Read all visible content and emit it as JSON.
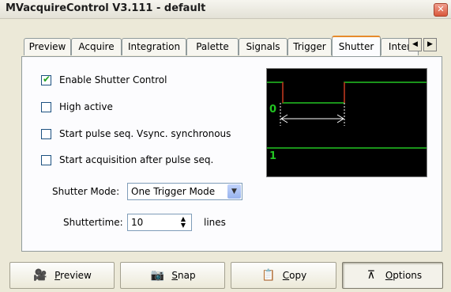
{
  "window": {
    "title": "MVacquireControl  V3.111 - default",
    "close_glyph": "✕"
  },
  "tabs": [
    {
      "label": "Preview"
    },
    {
      "label": "Acquire"
    },
    {
      "label": "Integration"
    },
    {
      "label": "Palette"
    },
    {
      "label": "Signals"
    },
    {
      "label": "Trigger"
    },
    {
      "label": "Shutter",
      "active": true
    },
    {
      "label": "Inter"
    }
  ],
  "tab_scroll": {
    "left": "◀",
    "right": "▶"
  },
  "options": [
    {
      "label": "Enable Shutter Control",
      "checked": true
    },
    {
      "label": "High active",
      "checked": false
    },
    {
      "label": "Start pulse seq. Vsync. synchronous",
      "checked": false
    },
    {
      "label": "Start acquisition after pulse seq.",
      "checked": false
    }
  ],
  "shutter_mode": {
    "label": "Shutter Mode:",
    "value": "One Trigger Mode"
  },
  "shuttertime": {
    "label": "Shuttertime:",
    "value": "10",
    "unit": "lines"
  },
  "diagram": {
    "label_0": "0",
    "label_1": "1",
    "trace_color": "#22c422",
    "marker_color": "#c41a1a",
    "arrow_color": "#ffffff"
  },
  "buttons": [
    {
      "prefix": "",
      "access": "P",
      "rest": "review",
      "icon": "camera-icon",
      "glyph": "🎥"
    },
    {
      "prefix": "",
      "access": "S",
      "rest": "nap",
      "icon": "snapshot-icon",
      "glyph": "📷"
    },
    {
      "prefix": "",
      "access": "C",
      "rest": "opy",
      "icon": "copy-icon",
      "glyph": "📋"
    },
    {
      "prefix": "",
      "access": "O",
      "rest": "ptions",
      "icon": "options-icon",
      "glyph": "⊼"
    }
  ]
}
